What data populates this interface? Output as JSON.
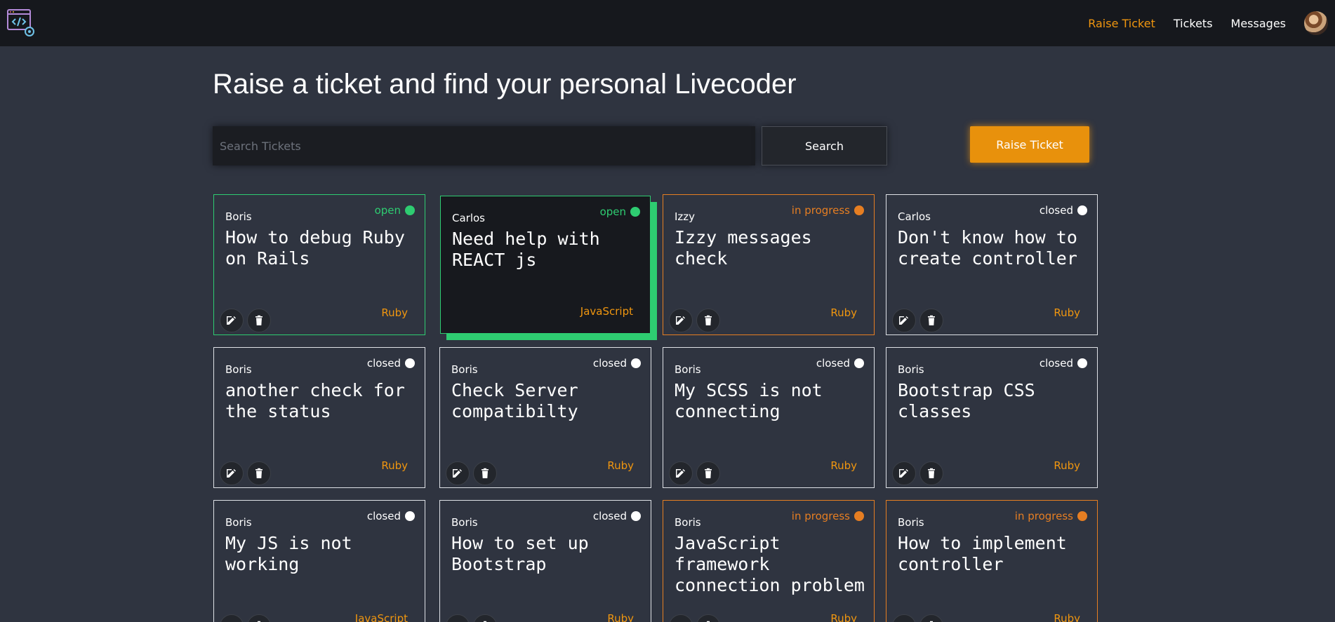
{
  "nav": {
    "raise_ticket": "Raise Ticket",
    "tickets": "Tickets",
    "messages": "Messages"
  },
  "header": {
    "title": "Raise a ticket and find your personal Livecoder"
  },
  "search": {
    "placeholder": "Search Tickets",
    "value": "",
    "button_label": "Search"
  },
  "raise_button_label": "Raise Ticket",
  "colors": {
    "accent": "#f0960f",
    "open": "#2ecc71",
    "in_progress": "#e67e22",
    "closed": "#ffffff",
    "background": "#2f3440",
    "navbar": "#16181d"
  },
  "tickets": [
    {
      "author": "Boris",
      "status": "open",
      "title": "How to debug Ruby on Rails",
      "language": "Ruby"
    },
    {
      "author": "Carlos",
      "status": "open",
      "title": "Need help with REACT js",
      "language": "JavaScript"
    },
    {
      "author": "Izzy",
      "status": "in progress",
      "title": "Izzy messages check",
      "language": "Ruby"
    },
    {
      "author": "Carlos",
      "status": "closed",
      "title": "Don't know how to create controller",
      "language": "Ruby"
    },
    {
      "author": "Boris",
      "status": "closed",
      "title": "another check for the status",
      "language": "Ruby"
    },
    {
      "author": "Boris",
      "status": "closed",
      "title": "Check Server compatibilty",
      "language": "Ruby"
    },
    {
      "author": "Boris",
      "status": "closed",
      "title": "My SCSS is not connecting",
      "language": "Ruby"
    },
    {
      "author": "Boris",
      "status": "closed",
      "title": "Bootstrap CSS classes",
      "language": "Ruby"
    },
    {
      "author": "Boris",
      "status": "closed",
      "title": "My JS is not working",
      "language": "JavaScript"
    },
    {
      "author": "Boris",
      "status": "closed",
      "title": "How to set up Bootstrap",
      "language": "Ruby"
    },
    {
      "author": "Boris",
      "status": "in progress",
      "title": "JavaScript framework connection problem",
      "language": "Ruby"
    },
    {
      "author": "Boris",
      "status": "in progress",
      "title": "How to implement controller",
      "language": "Ruby"
    }
  ]
}
